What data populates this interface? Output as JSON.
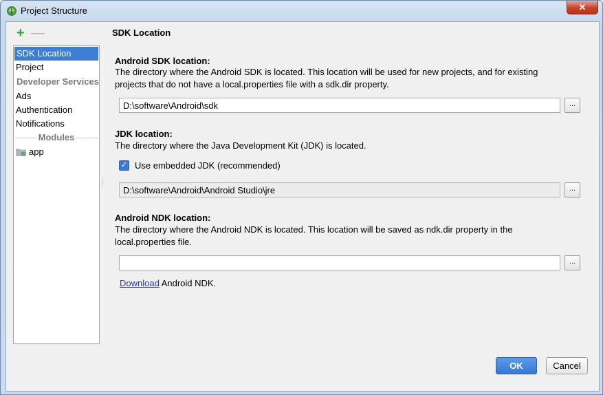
{
  "window": {
    "title": "Project Structure",
    "close_glyph": "✕"
  },
  "toolbar": {
    "add_glyph": "+",
    "remove_glyph": "—"
  },
  "sidebar": {
    "items": [
      {
        "label": "SDK Location"
      },
      {
        "label": "Project"
      }
    ],
    "developer_services_header": "Developer Services",
    "services": [
      {
        "label": "Ads"
      },
      {
        "label": "Authentication"
      },
      {
        "label": "Notifications"
      }
    ],
    "modules_header": "Modules",
    "modules": [
      {
        "label": "app"
      }
    ]
  },
  "main": {
    "page_title": "SDK Location",
    "android_sdk": {
      "title": "Android SDK location:",
      "description_line1": "The directory where the Android SDK is located. This location will be used for new projects, and for existing",
      "description_line2": "projects that do not have a local.properties file with a sdk.dir property.",
      "path": "D:\\software\\Android\\sdk"
    },
    "jdk": {
      "title": "JDK location:",
      "description": "The directory where the Java Development Kit (JDK) is located.",
      "embedded_label": "Use embedded JDK (recommended)",
      "embedded_checked": true,
      "path": "D:\\software\\Android\\Android Studio\\jre"
    },
    "ndk": {
      "title": "Android NDK location:",
      "description_line1": "The directory where the Android NDK is located. This location will be saved as ndk.dir property in the",
      "description_line2": "local.properties file.",
      "path": "",
      "download_link": "Download",
      "download_suffix": " Android NDK."
    },
    "browse_label": "..."
  },
  "footer": {
    "ok_label": "OK",
    "cancel_label": "Cancel"
  },
  "colors": {
    "accent": "#3d7dd3",
    "link": "#1a3ccc",
    "add": "#3aa13a"
  }
}
